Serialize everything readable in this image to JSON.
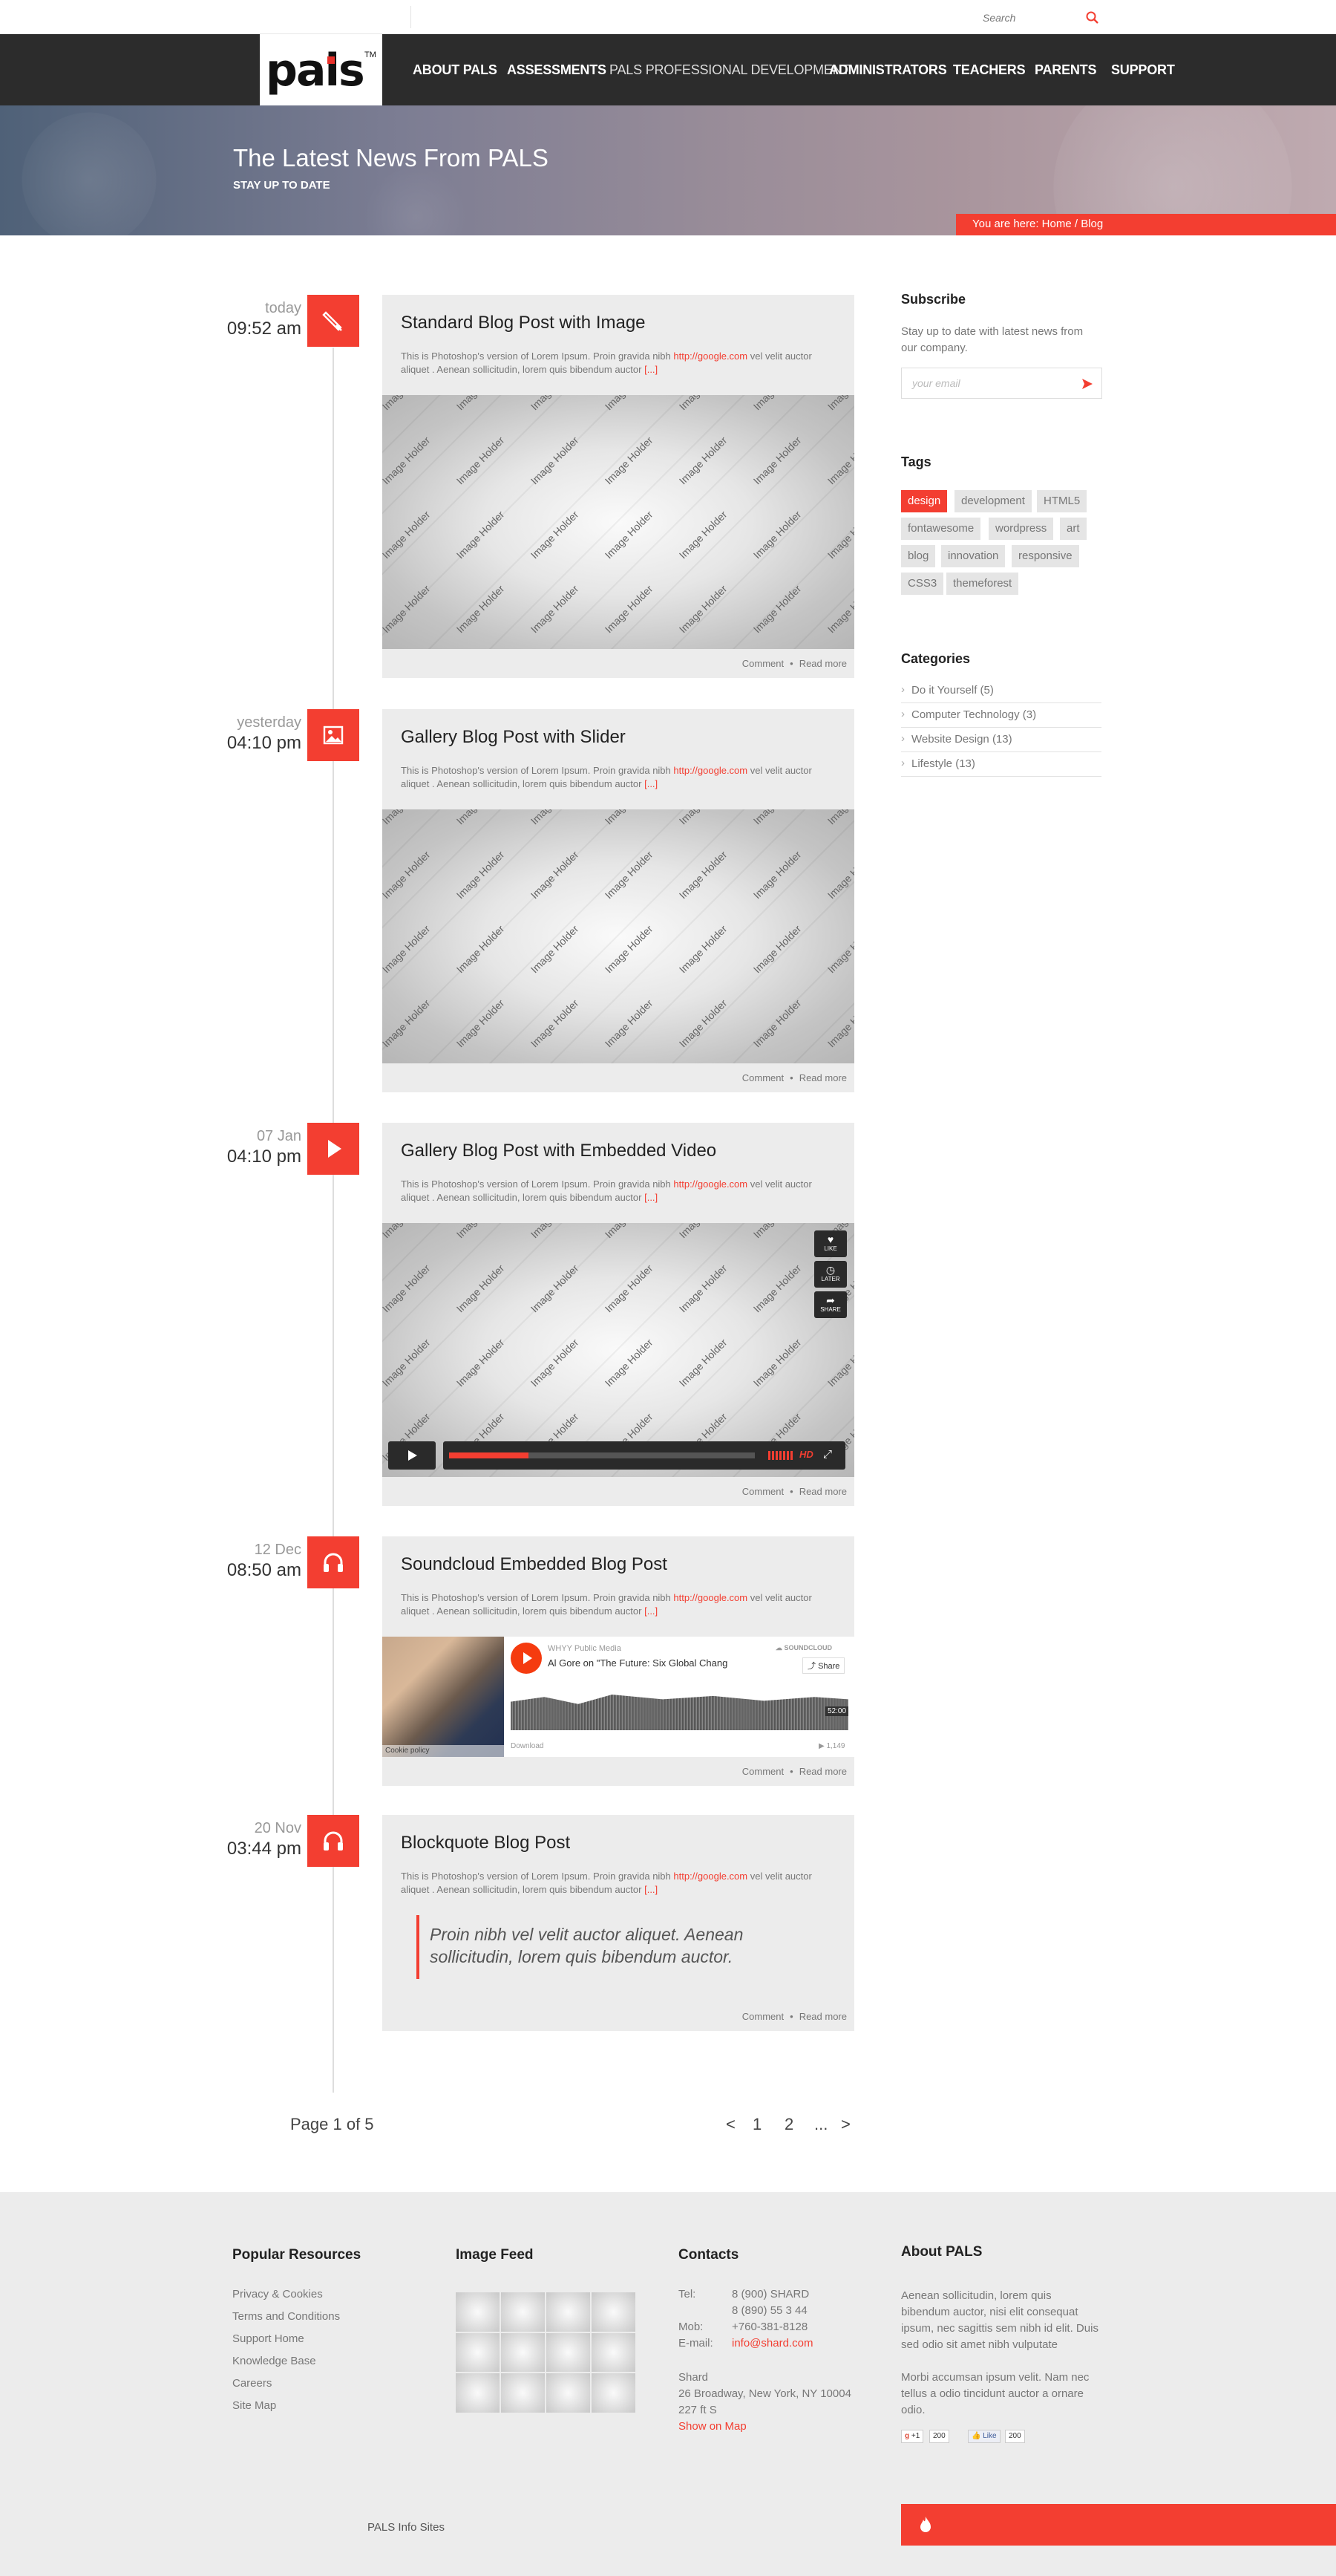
{
  "topbar": {
    "search_placeholder": "Search"
  },
  "logo": {
    "text": "pals",
    "tm": "TM"
  },
  "nav": [
    "ABOUT PALS",
    "ASSESSMENTS",
    "PALS PROFESSIONAL DEVELOPMENT",
    "ADMINISTRATORS",
    "TEACHERS",
    "PARENTS",
    "SUPPORT"
  ],
  "hero": {
    "title": "The Latest News From PALS",
    "subtitle": "STAY UP TO DATE",
    "breadcrumb": "You are here: Home / Blog"
  },
  "watermark": "Image Holder",
  "posts": [
    {
      "day": "today",
      "time": "09:52 am",
      "icon": "pen-icon",
      "title": "Standard Blog Post with Image",
      "excerpt_1": "This is Photoshop's version  of Lorem Ipsum. Proin gravida nibh ",
      "link": "http://google.com",
      "excerpt_2": " vel velit auctor aliquet . Aenean sollicitudin, lorem quis bibendum auctor ",
      "more": "[...]",
      "comment": "Comment",
      "read": "Read more"
    },
    {
      "day": "yesterday",
      "time": "04:10 pm",
      "icon": "image-icon",
      "title": "Gallery Blog Post with Slider",
      "excerpt_1": "This is Photoshop's version  of Lorem Ipsum. Proin gravida nibh ",
      "link": "http://google.com",
      "excerpt_2": " vel velit auctor aliquet . Aenean sollicitudin, lorem quis bibendum auctor ",
      "more": "[...]",
      "comment": "Comment",
      "read": "Read more"
    },
    {
      "day": "07 Jan",
      "time": "04:10 pm",
      "icon": "play-icon",
      "title": "Gallery Blog Post with Embedded Video",
      "excerpt_1": "This is Photoshop's version  of Lorem Ipsum. Proin gravida nibh ",
      "link": "http://google.com",
      "excerpt_2": " vel velit auctor aliquet . Aenean sollicitudin, lorem quis bibendum auctor ",
      "more": "[...]",
      "comment": "Comment",
      "read": "Read more"
    },
    {
      "day": "12 Dec",
      "time": "08:50 am",
      "icon": "headphones-icon",
      "title": "Soundcloud Embedded Blog Post",
      "excerpt_1": "This is Photoshop's version  of Lorem Ipsum. Proin gravida nibh ",
      "link": "http://google.com",
      "excerpt_2": " vel velit auctor aliquet . Aenean sollicitudin, lorem quis bibendum auctor ",
      "more": "[...]",
      "comment": "Comment",
      "read": "Read more"
    },
    {
      "day": "20 Nov",
      "time": "03:44 pm",
      "icon": "headphones-icon",
      "title": "Blockquote Blog Post",
      "excerpt_1": "This is Photoshop's version  of Lorem Ipsum. Proin gravida nibh ",
      "link": "http://google.com",
      "excerpt_2": " vel velit auctor aliquet . Aenean sollicitudin, lorem quis bibendum auctor ",
      "more": "[...]",
      "comment": "Comment",
      "read": "Read more",
      "quote": "Proin nibh vel velit auctor aliquet. Aenean sollicitudin, lorem quis bibendum auctor."
    }
  ],
  "video": {
    "like": "LIKE",
    "later": "LATER",
    "share": "SHARE",
    "hd": "HD",
    "progress": 0.26
  },
  "soundcloud": {
    "publisher": "WHYY Public Media",
    "track": "Al Gore on \"The Future: Six Global Chang",
    "brand": "SOUNDCLOUD",
    "share": "Share",
    "duration": "52:00",
    "download": "Download",
    "plays": "1,149",
    "cookie": "Cookie policy"
  },
  "sidebar": {
    "subscribe_title": "Subscribe",
    "subscribe_text": "Stay up to date with latest news from our company.",
    "email_placeholder": "your email",
    "tags_title": "Tags",
    "tags": [
      "design",
      "development",
      "HTML5",
      "fontawesome",
      "wordpress",
      "art",
      "blog",
      "innovation",
      "responsive",
      "CSS3",
      "themeforest"
    ],
    "categories_title": "Categories",
    "categories": [
      "Do it Yourself (5)",
      "Computer Technology (3)",
      "Website Design (13)",
      "Lifestyle (13)"
    ]
  },
  "pagination": {
    "label": "Page 1 of 5",
    "prev": "<",
    "p1": "1",
    "p2": "2",
    "dots": "...",
    "next": ">"
  },
  "footer": {
    "resources_title": "Popular Resources",
    "resources": [
      "Privacy & Cookies",
      "Terms and Conditions",
      "Support Home",
      "Knowledge Base",
      "Careers",
      "Site Map"
    ],
    "feed_title": "Image Feed",
    "contacts_title": "Contacts",
    "tel_label": "Tel:",
    "tel_1": "8 (900) SHARD",
    "tel_2": "8 (890) 55 3 44",
    "mob_label": "Mob:",
    "mob": "+760-381-8128",
    "email_label": "E-mail:",
    "email": "info@shard.com",
    "company": "Shard",
    "address_1": "26 Broadway, New York, NY 10004",
    "address_2": "227 ft S",
    "map_link": "Show on Map",
    "about_title": "About PALS",
    "about_1": "Aenean sollicitudin, lorem quis bibendum auctor, nisi elit consequat ipsum, nec sagittis sem nibh id elit. Duis sed odio sit amet nibh vulputate",
    "about_2": "Morbi accumsan ipsum velit. Nam nec tellus a odio tincidunt auctor a ornare odio.",
    "gplus": "+1",
    "gplus_count": "200",
    "fb": "Like",
    "fb_count": "200",
    "bottom": "PALS Info Sites"
  },
  "colors": {
    "accent": "#f33e31",
    "nav_bg": "#2c2c2c",
    "post_bg": "#ececec"
  }
}
